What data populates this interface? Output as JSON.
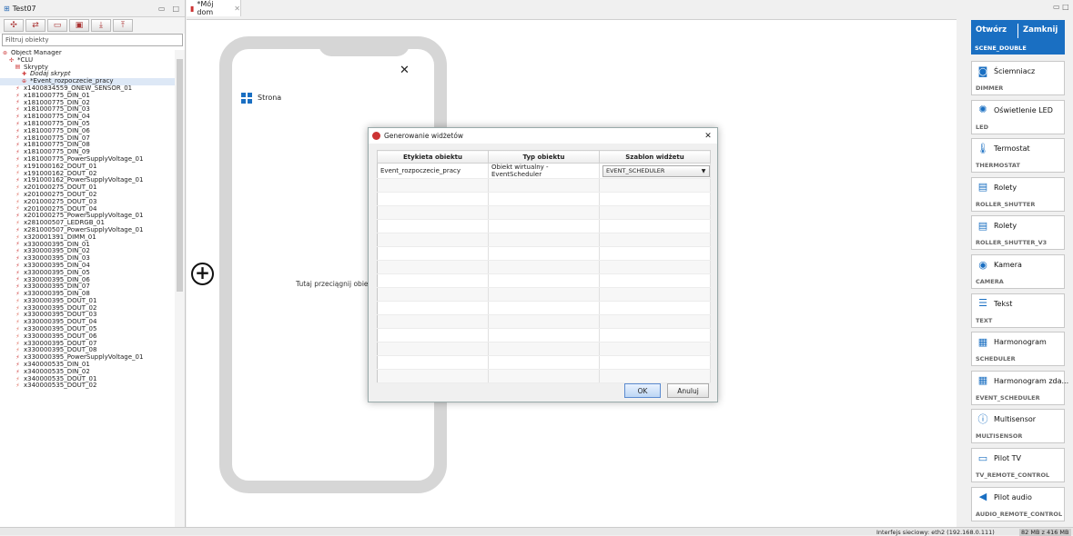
{
  "left_tab": {
    "title": "Test07"
  },
  "filter": {
    "placeholder": "Filtruj obiekty"
  },
  "tree": [
    {
      "label": "Object Manager",
      "indent": 0,
      "icon": "object-manager"
    },
    {
      "label": "*CLU",
      "indent": 1,
      "icon": "clu"
    },
    {
      "label": "Skrypty",
      "indent": 2,
      "icon": "scripts"
    },
    {
      "label": "Dodaj skrypt",
      "indent": 3,
      "icon": "add-script",
      "italic": true
    },
    {
      "label": "*Event_rozpoczecie_pracy",
      "indent": 3,
      "icon": "script",
      "selected": true
    },
    {
      "label": "x1400834559_ONEW_SENSOR_01",
      "indent": 2,
      "icon": "in"
    },
    {
      "label": "x181000775_DIN_01",
      "indent": 2,
      "icon": "in"
    },
    {
      "label": "x181000775_DIN_02",
      "indent": 2,
      "icon": "in"
    },
    {
      "label": "x181000775_DIN_03",
      "indent": 2,
      "icon": "in"
    },
    {
      "label": "x181000775_DIN_04",
      "indent": 2,
      "icon": "in"
    },
    {
      "label": "x181000775_DIN_05",
      "indent": 2,
      "icon": "in"
    },
    {
      "label": "x181000775_DIN_06",
      "indent": 2,
      "icon": "in"
    },
    {
      "label": "x181000775_DIN_07",
      "indent": 2,
      "icon": "in"
    },
    {
      "label": "x181000775_DIN_08",
      "indent": 2,
      "icon": "in"
    },
    {
      "label": "x181000775_DIN_09",
      "indent": 2,
      "icon": "in"
    },
    {
      "label": "x181000775_PowerSupplyVoltage_01",
      "indent": 2,
      "icon": "in"
    },
    {
      "label": "x191000162_DOUT_01",
      "indent": 2,
      "icon": "out"
    },
    {
      "label": "x191000162_DOUT_02",
      "indent": 2,
      "icon": "out"
    },
    {
      "label": "x191000162_PowerSupplyVoltage_01",
      "indent": 2,
      "icon": "in"
    },
    {
      "label": "x201000275_DOUT_01",
      "indent": 2,
      "icon": "out"
    },
    {
      "label": "x201000275_DOUT_02",
      "indent": 2,
      "icon": "out"
    },
    {
      "label": "x201000275_DOUT_03",
      "indent": 2,
      "icon": "out"
    },
    {
      "label": "x201000275_DOUT_04",
      "indent": 2,
      "icon": "out"
    },
    {
      "label": "x201000275_PowerSupplyVoltage_01",
      "indent": 2,
      "icon": "in"
    },
    {
      "label": "x281000507_LEDRGB_01",
      "indent": 2,
      "icon": "out"
    },
    {
      "label": "x281000507_PowerSupplyVoltage_01",
      "indent": 2,
      "icon": "in"
    },
    {
      "label": "x320001391_DIMM_01",
      "indent": 2,
      "icon": "out"
    },
    {
      "label": "x330000395_DIN_01",
      "indent": 2,
      "icon": "in"
    },
    {
      "label": "x330000395_DIN_02",
      "indent": 2,
      "icon": "in"
    },
    {
      "label": "x330000395_DIN_03",
      "indent": 2,
      "icon": "in"
    },
    {
      "label": "x330000395_DIN_04",
      "indent": 2,
      "icon": "in"
    },
    {
      "label": "x330000395_DIN_05",
      "indent": 2,
      "icon": "in"
    },
    {
      "label": "x330000395_DIN_06",
      "indent": 2,
      "icon": "in"
    },
    {
      "label": "x330000395_DIN_07",
      "indent": 2,
      "icon": "in"
    },
    {
      "label": "x330000395_DIN_08",
      "indent": 2,
      "icon": "in"
    },
    {
      "label": "x330000395_DOUT_01",
      "indent": 2,
      "icon": "out"
    },
    {
      "label": "x330000395_DOUT_02",
      "indent": 2,
      "icon": "out"
    },
    {
      "label": "x330000395_DOUT_03",
      "indent": 2,
      "icon": "out"
    },
    {
      "label": "x330000395_DOUT_04",
      "indent": 2,
      "icon": "out"
    },
    {
      "label": "x330000395_DOUT_05",
      "indent": 2,
      "icon": "out"
    },
    {
      "label": "x330000395_DOUT_06",
      "indent": 2,
      "icon": "out"
    },
    {
      "label": "x330000395_DOUT_07",
      "indent": 2,
      "icon": "out"
    },
    {
      "label": "x330000395_DOUT_08",
      "indent": 2,
      "icon": "out"
    },
    {
      "label": "x330000395_PowerSupplyVoltage_01",
      "indent": 2,
      "icon": "in"
    },
    {
      "label": "x340000535_DIN_01",
      "indent": 2,
      "icon": "in"
    },
    {
      "label": "x340000535_DIN_02",
      "indent": 2,
      "icon": "in"
    },
    {
      "label": "x340000535_DOUT_01",
      "indent": 2,
      "icon": "out"
    },
    {
      "label": "x340000535_DOUT_02",
      "indent": 2,
      "icon": "out"
    }
  ],
  "editor_tab": {
    "title": "*Mój dom"
  },
  "canvas": {
    "page_label": "Strona",
    "drop_hint": "Tutaj przeciągnij obiekt"
  },
  "dialog": {
    "title": "Generowanie widżetów",
    "columns": [
      "Etykieta obiektu",
      "Typ obiektu",
      "Szablon widżetu"
    ],
    "rows": [
      [
        "Event_rozpoczecie_pracy",
        "Obiekt wirtualny - EventScheduler",
        "EVENT_SCHEDULER"
      ]
    ],
    "ok": "OK",
    "cancel": "Anuluj"
  },
  "palette": {
    "scene": {
      "open": "Otwórz",
      "close": "Zamknij",
      "type": "SCENE_DOUBLE"
    },
    "items": [
      {
        "name": "Ściemniacz",
        "type": "DIMMER",
        "icon": "dimmer-icon",
        "glyph": "◙"
      },
      {
        "name": "Oświetlenie LED",
        "type": "LED",
        "icon": "led-icon",
        "glyph": "✺"
      },
      {
        "name": "Termostat",
        "type": "THERMOSTAT",
        "icon": "thermometer-icon",
        "glyph": "🌡"
      },
      {
        "name": "Rolety",
        "type": "ROLLER_SHUTTER",
        "icon": "shutter-icon",
        "glyph": "▤"
      },
      {
        "name": "Rolety",
        "type": "ROLLER_SHUTTER_V3",
        "icon": "shutter-icon",
        "glyph": "▤"
      },
      {
        "name": "Kamera",
        "type": "CAMERA",
        "icon": "camera-icon",
        "glyph": "◉"
      },
      {
        "name": "Tekst",
        "type": "TEXT",
        "icon": "text-icon",
        "glyph": "☰"
      },
      {
        "name": "Harmonogram",
        "type": "SCHEDULER",
        "icon": "calendar-icon",
        "glyph": "▦"
      },
      {
        "name": "Harmonogram zda...",
        "type": "EVENT_SCHEDULER",
        "icon": "calendar-icon",
        "glyph": "▦"
      },
      {
        "name": "Multisensor",
        "type": "MULTISENSOR",
        "icon": "multisensor-icon",
        "glyph": "ⓘ"
      },
      {
        "name": "Pilot TV",
        "type": "TV_REMOTE_CONTROL",
        "icon": "tv-icon",
        "glyph": "▭"
      },
      {
        "name": "Pilot audio",
        "type": "AUDIO_REMOTE_CONTROL",
        "icon": "speaker-icon",
        "glyph": "◀"
      }
    ]
  },
  "status": {
    "network": "Interfejs sieciowy: eth2 (192.168.0.111)",
    "memory": "82 MB z 416 MB"
  }
}
